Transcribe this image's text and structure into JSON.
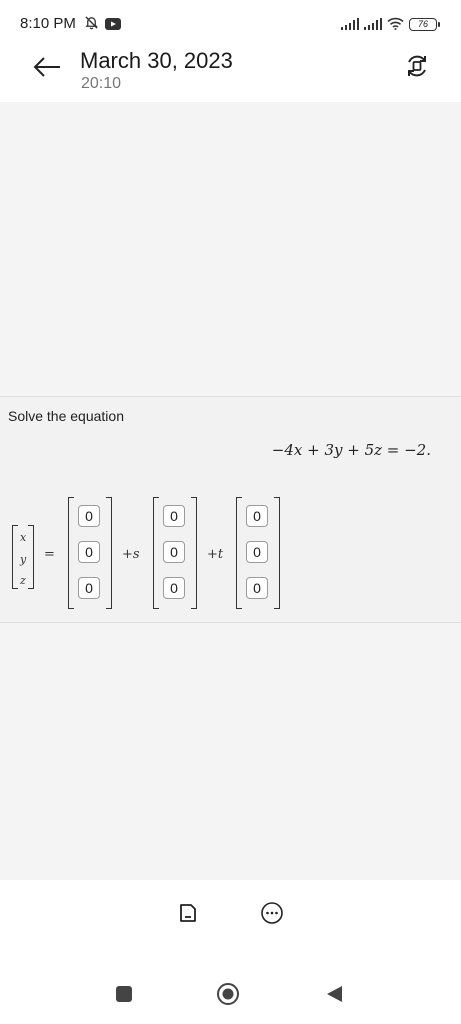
{
  "status_bar": {
    "time": "8:10 PM",
    "battery": "76",
    "icons": [
      "mute-bell-icon",
      "youtube-icon",
      "signal-icon",
      "signal-icon",
      "wifi-icon",
      "battery-icon"
    ]
  },
  "header": {
    "title": "March 30, 2023",
    "subtitle": "20:10",
    "icons": [
      "back-arrow-icon",
      "rotate-icon"
    ]
  },
  "problem": {
    "instruction": "Solve the equation",
    "equation": "−4x + 3y + 5z = −2.",
    "variables": [
      "x",
      "y",
      "z"
    ],
    "equals": "=",
    "plus_s": "+s",
    "plus_t": "+t",
    "vector_constant": [
      "0",
      "0",
      "0"
    ],
    "vector_s": [
      "0",
      "0",
      "0"
    ],
    "vector_t": [
      "0",
      "0",
      "0"
    ]
  },
  "toolbar": {
    "icons": [
      "document-icon",
      "more-icon"
    ]
  },
  "nav": {
    "icons": [
      "recents-square-icon",
      "home-circle-icon",
      "back-triangle-icon"
    ]
  },
  "colors": {
    "background": "#ffffff",
    "content_bg": "#f4f4f4",
    "panel_bg": "#f2f2f2",
    "text": "#222222",
    "subtle_text": "#777777"
  }
}
